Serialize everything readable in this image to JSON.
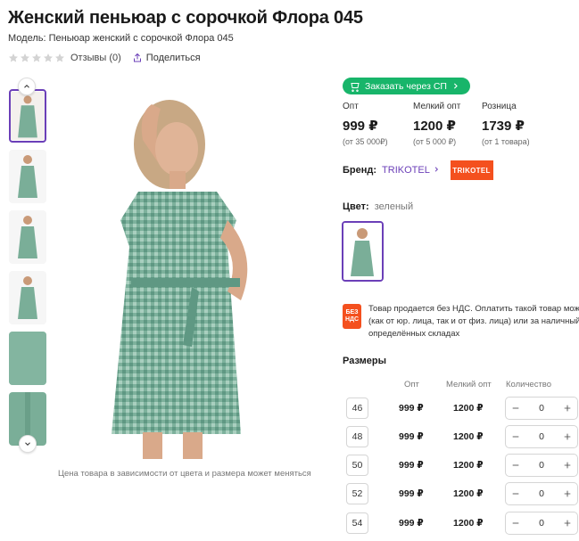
{
  "product": {
    "title": "Женский пеньюар с сорочкой Флора 045",
    "model": "Модель: Пеньюар женский с сорочкой Флора 045",
    "reviews": "Отзывы (0)",
    "share": "Поделиться",
    "image_caption": "Цена товара в зависимости от цвета и размера может меняться"
  },
  "sp_button": {
    "label": "Заказать через СП"
  },
  "prices": [
    {
      "label": "Опт",
      "value": "999 ₽",
      "note": "(от 35 000₽)"
    },
    {
      "label": "Мелкий опт",
      "value": "1200 ₽",
      "note": "(от 5 000 ₽)"
    },
    {
      "label": "Розница",
      "value": "1739 ₽",
      "note": "(от 1 товара)"
    }
  ],
  "brand": {
    "label": "Бренд:",
    "name": "TRIKOTEL",
    "logo_text": "TRIKOTEL"
  },
  "color": {
    "label": "Цвет:",
    "value": "зеленый"
  },
  "vat": {
    "badge_line1": "БЕЗ",
    "badge_line2": "НДС",
    "text": "Товар продается без НДС. Оплатить такой товар можно (как от юр. лица, так и от физ. лица) или за наличный р определённых складах"
  },
  "sizes": {
    "title": "Размеры",
    "headers": {
      "opt": "Опт",
      "small_opt": "Мелкий опт",
      "qty": "Количество"
    },
    "rows": [
      {
        "size": "46",
        "opt": "999 ₽",
        "small_opt": "1200 ₽",
        "qty": "0"
      },
      {
        "size": "48",
        "opt": "999 ₽",
        "small_opt": "1200 ₽",
        "qty": "0"
      },
      {
        "size": "50",
        "opt": "999 ₽",
        "small_opt": "1200 ₽",
        "qty": "0"
      },
      {
        "size": "52",
        "opt": "999 ₽",
        "small_opt": "1200 ₽",
        "qty": "0"
      },
      {
        "size": "54",
        "opt": "999 ₽",
        "small_opt": "1200 ₽",
        "qty": "0"
      }
    ]
  },
  "icons": {
    "star": "star-icon",
    "share": "share-icon",
    "cart": "cart-icon",
    "chevron": "chevron-right-icon"
  },
  "colors": {
    "accent_purple": "#6b3fb8",
    "sp_green": "#18b56a",
    "brand_orange": "#f4501e",
    "dress_green": "#6fa58f"
  }
}
